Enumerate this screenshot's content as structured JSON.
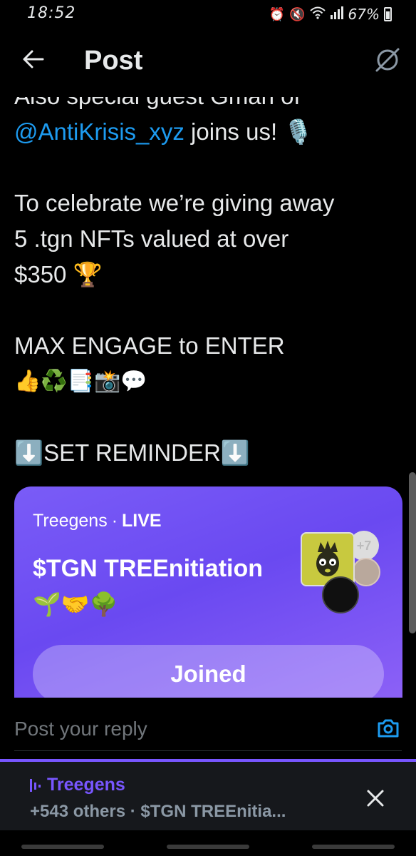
{
  "status_bar": {
    "time": "18:52",
    "icons": [
      "alarm-icon",
      "mute-icon",
      "wifi-icon",
      "signal-icon"
    ],
    "battery": "67%"
  },
  "header": {
    "title": "Post"
  },
  "tweet": {
    "line1": "Also special guest Gman of",
    "mention": "@AntiKrisis_xyz",
    "line2_rest": " joins us! 🎙️",
    "line3": "To celebrate we’re giving away",
    "line4": "5 .tgn NFTs valued at over",
    "line5": "$350 🏆",
    "line6": "MAX ENGAGE to ENTER",
    "line7": "👍♻️📑📸💬",
    "line8": "⬇️SET REMINDER⬇️"
  },
  "space_card": {
    "host": "Treegens",
    "separator": "·",
    "status": "LIVE",
    "title": "$TGN TREEnitiation",
    "emojis": "🌱🤝🌳",
    "extra_count": "+7",
    "button_label": "Joined"
  },
  "reply": {
    "placeholder": "Post your reply"
  },
  "space_bar": {
    "name": "Treegens",
    "subtitle": "+543 others · $TGN TREEnitia..."
  },
  "colors": {
    "accent": "#1d9bf0",
    "space_purple": "#7856ff",
    "background": "#000000"
  }
}
